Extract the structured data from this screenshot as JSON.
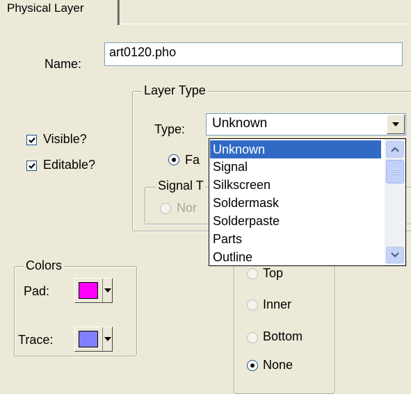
{
  "tabs": [
    {
      "label": "Physical Layer"
    }
  ],
  "name_field": {
    "label": "Name:",
    "value": "art0120.pho"
  },
  "options": {
    "visible": {
      "label": "Visible?",
      "checked": true
    },
    "editable": {
      "label": "Editable?",
      "checked": true
    }
  },
  "layer_type": {
    "group_label": "Layer Type",
    "type_label": "Type:",
    "selected": "Unknown",
    "partial_radio_label": "Fa",
    "signal_group_label": "Signal T",
    "signal_radio_label": "Nor",
    "dropdown_items": [
      "Unknown",
      "Signal",
      "Silkscreen",
      "Soldermask",
      "Solderpaste",
      "Parts",
      "Outline"
    ]
  },
  "colors": {
    "group_label": "Colors",
    "pad": {
      "label": "Pad:",
      "color": "#ff00ff"
    },
    "trace": {
      "label": "Trace:",
      "color": "#8080ff"
    }
  },
  "side_options": {
    "items": [
      {
        "label": "Top",
        "selected": false
      },
      {
        "label": "Inner",
        "selected": false
      },
      {
        "label": "Bottom",
        "selected": false
      },
      {
        "label": "None",
        "selected": true
      }
    ]
  }
}
